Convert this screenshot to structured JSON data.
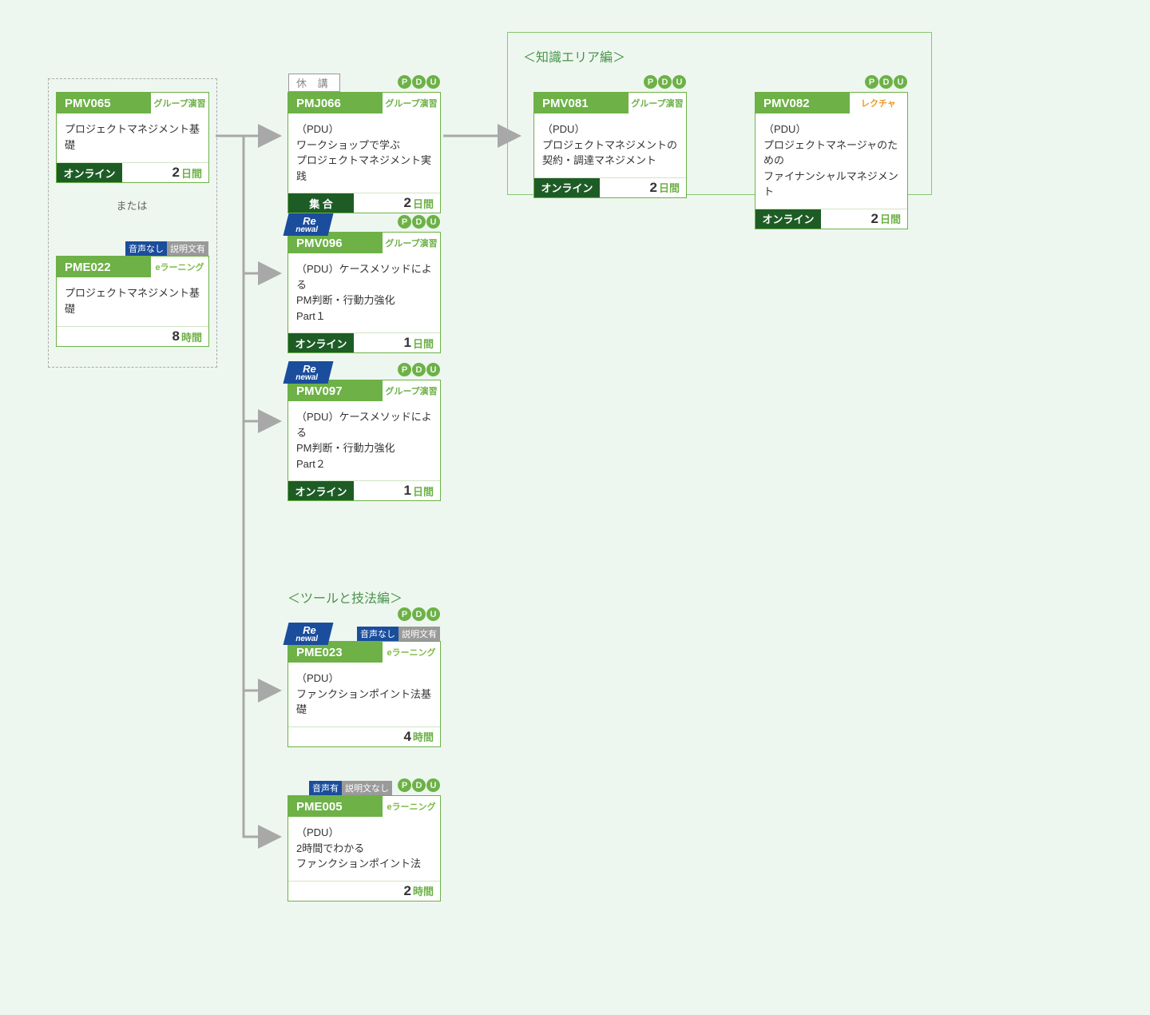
{
  "headings": {
    "knowledge": "＜知識エリア編＞",
    "tools": "＜ツールと技法編＞",
    "or": "または"
  },
  "badges": {
    "pdu": [
      "P",
      "D",
      "U"
    ],
    "renewal": [
      "Re",
      "newal"
    ],
    "kyuko": "休 講",
    "audio_none_desc_yes": [
      "音声なし",
      "説明文有"
    ],
    "audio_yes_desc_none": [
      "音声有",
      "説明文なし"
    ]
  },
  "tags": {
    "group": "グループ演習",
    "lecture": "レクチャ",
    "elearn": "eラーニング"
  },
  "units": {
    "days": "日間",
    "hours": "時間"
  },
  "modes": {
    "online": "オンライン",
    "shukai": "集 合"
  },
  "cards": {
    "pmv065": {
      "code": "PMV065",
      "title_l1": "プロジェクトマネジメント基礎",
      "dur_num": "2"
    },
    "pme022": {
      "code": "PME022",
      "title_l1": "プロジェクトマネジメント基礎",
      "dur_num": "8"
    },
    "pmj066": {
      "code": "PMJ066",
      "title_l1": "（PDU）",
      "title_l2": "ワークショップで学ぶ",
      "title_l3": "プロジェクトマネジメント実践",
      "dur_num": "2"
    },
    "pmv096": {
      "code": "PMV096",
      "title_l1": "（PDU）ケースメソッドによる",
      "title_l2": "PM判断・行動力強化",
      "title_l3": "Part１",
      "dur_num": "1"
    },
    "pmv097": {
      "code": "PMV097",
      "title_l1": "（PDU）ケースメソッドによる",
      "title_l2": "PM判断・行動力強化",
      "title_l3": "Part２",
      "dur_num": "1"
    },
    "pme023": {
      "code": "PME023",
      "title_l1": "（PDU）",
      "title_l2": "ファンクションポイント法基礎",
      "dur_num": "4"
    },
    "pme005": {
      "code": "PME005",
      "title_l1": "（PDU）",
      "title_l2": "2時間でわかる",
      "title_l3": "ファンクションポイント法",
      "dur_num": "2"
    },
    "pmv081": {
      "code": "PMV081",
      "title_l1": "（PDU）",
      "title_l2": "プロジェクトマネジメントの",
      "title_l3": "契約・調達マネジメント",
      "dur_num": "2"
    },
    "pmv082": {
      "code": "PMV082",
      "title_l1": "（PDU）",
      "title_l2": "プロジェクトマネージャのための",
      "title_l3": "ファイナンシャルマネジメント",
      "dur_num": "2"
    }
  }
}
